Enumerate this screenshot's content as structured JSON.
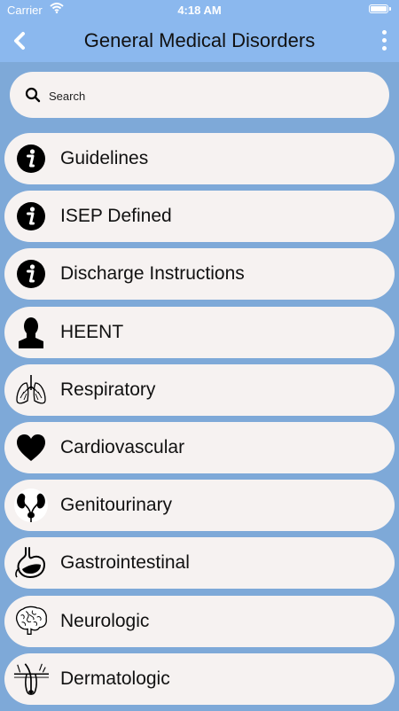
{
  "status_bar": {
    "carrier": "Carrier",
    "time": "4:18 AM"
  },
  "header": {
    "title": "General Medical Disorders"
  },
  "search": {
    "placeholder": "Search",
    "value": ""
  },
  "menu": {
    "items": [
      {
        "label": "Guidelines",
        "icon": "info-icon"
      },
      {
        "label": "ISEP Defined",
        "icon": "info-icon"
      },
      {
        "label": "Discharge Instructions",
        "icon": "info-icon"
      },
      {
        "label": "HEENT",
        "icon": "person-bust-icon"
      },
      {
        "label": "Respiratory",
        "icon": "lungs-icon"
      },
      {
        "label": "Cardiovascular",
        "icon": "heart-icon"
      },
      {
        "label": "Genitourinary",
        "icon": "kidneys-icon"
      },
      {
        "label": "Gastrointestinal",
        "icon": "stomach-icon"
      },
      {
        "label": "Neurologic",
        "icon": "brain-icon"
      },
      {
        "label": "Dermatologic",
        "icon": "skin-follicle-icon"
      }
    ]
  }
}
